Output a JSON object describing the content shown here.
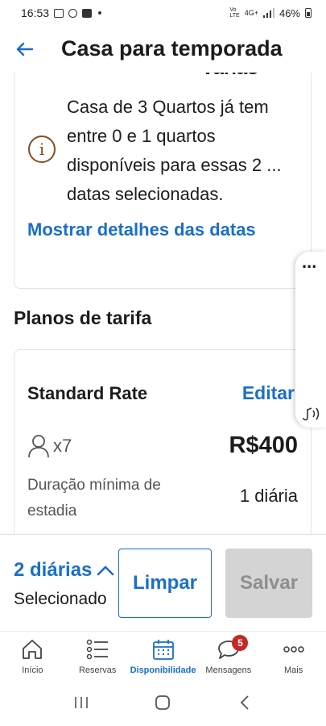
{
  "status_bar": {
    "time": "16:53",
    "network": "4G+",
    "battery": "46%"
  },
  "header": {
    "title": "Casa para temporada",
    "back_icon": "arrow-left-icon"
  },
  "availability_card": {
    "cut_text": "Variás",
    "message": "Casa de 3 Quartos já tem entre 0 e 1 quartos disponíveis para essas 2 ... datas selecionadas.",
    "link": "Mostrar detalhes das datas",
    "icon": "info-icon"
  },
  "rate_plans": {
    "section_title": "Planos de tarifa",
    "plan": {
      "name": "Standard Rate",
      "edit_label": "Editar",
      "guests": "x7",
      "price": "R$400",
      "min_stay_label": "Duração mínima de estadia",
      "min_stay_value": "1 diária"
    }
  },
  "float_panel": {
    "dots": "...",
    "icon": "audio-icon"
  },
  "bottom_action": {
    "selected_count": "2 diárias",
    "selected_label": "Selecionado",
    "clear_label": "Limpar",
    "save_label": "Salvar"
  },
  "tabs": [
    {
      "label": "Início",
      "icon": "home-icon"
    },
    {
      "label": "Reservas",
      "icon": "list-icon"
    },
    {
      "label": "Disponibilidade",
      "icon": "calendar-icon",
      "active": true
    },
    {
      "label": "Mensagens",
      "icon": "chat-icon",
      "badge": "5"
    },
    {
      "label": "Mais",
      "icon": "more-icon"
    }
  ],
  "colors": {
    "accent": "#1a6fc9",
    "badge": "#c62828",
    "info_icon": "#8a4b1e",
    "disabled_button": "#d4d4d4"
  }
}
